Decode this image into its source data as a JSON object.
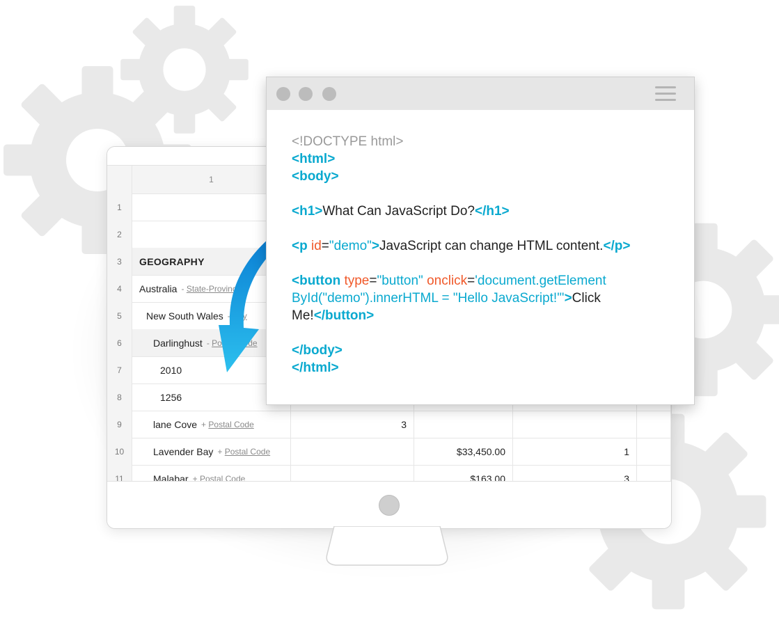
{
  "spreadsheet": {
    "column_header": "1",
    "rows": [
      {
        "num": "1",
        "label": "",
        "sub_prefix": "",
        "sub_link": "",
        "values": [
          "",
          "",
          "",
          ""
        ]
      },
      {
        "num": "2",
        "label": "",
        "sub_prefix": "",
        "sub_link": "",
        "values": [
          "",
          "",
          "",
          ""
        ]
      },
      {
        "num": "3",
        "label": "GEOGRAPHY",
        "sub_prefix": "",
        "sub_link": "",
        "values": [
          "",
          "",
          "",
          ""
        ]
      },
      {
        "num": "4",
        "label": "Australia",
        "sub_prefix": "-",
        "sub_link": "State-Province",
        "values": [
          "",
          "",
          "",
          ""
        ]
      },
      {
        "num": "5",
        "label": "New South Wales",
        "sub_prefix": "-",
        "sub_link": "City",
        "values": [
          "",
          "",
          "",
          ""
        ]
      },
      {
        "num": "6",
        "label": "Darlinghust",
        "sub_prefix": "-",
        "sub_link": "Postal Code",
        "values": [
          "",
          "",
          "",
          ""
        ]
      },
      {
        "num": "7",
        "label": "2010",
        "sub_prefix": "",
        "sub_link": "",
        "values": [
          "",
          "",
          "",
          ""
        ]
      },
      {
        "num": "8",
        "label": "1256",
        "sub_prefix": "",
        "sub_link": "",
        "values": [
          "",
          "",
          "",
          ""
        ]
      },
      {
        "num": "9",
        "label": "lane Cove",
        "sub_prefix": "+",
        "sub_link": "Postal Code",
        "values": [
          "3",
          "",
          "",
          ""
        ]
      },
      {
        "num": "10",
        "label": "Lavender Bay",
        "sub_prefix": "+",
        "sub_link": "Postal Code",
        "values": [
          "",
          "$33,450.00",
          "1",
          ""
        ]
      },
      {
        "num": "11",
        "label": "Malabar",
        "sub_prefix": "+",
        "sub_link": "Postal Code",
        "values": [
          "",
          "$163.00",
          "3",
          ""
        ]
      }
    ]
  },
  "code_window": {
    "lines": [
      [
        {
          "t": "<!DOCTYPE html>",
          "k": "doctype"
        }
      ],
      [
        {
          "t": "<html>",
          "k": "tag"
        }
      ],
      [
        {
          "t": "<body>",
          "k": "tag"
        }
      ],
      [],
      [
        {
          "t": "<h1>",
          "k": "tag"
        },
        {
          "t": "What Can JavaScript Do?",
          "k": "text"
        },
        {
          "t": "</h1>",
          "k": "tag"
        }
      ],
      [],
      [
        {
          "t": "<p ",
          "k": "tag"
        },
        {
          "t": "id",
          "k": "attr"
        },
        {
          "t": "=",
          "k": "eq"
        },
        {
          "t": "\"demo\"",
          "k": "str"
        },
        {
          "t": ">",
          "k": "tag"
        },
        {
          "t": "JavaScript can change HTML content.",
          "k": "text"
        },
        {
          "t": "</p>",
          "k": "tag"
        }
      ],
      [],
      [
        {
          "t": "<button ",
          "k": "tag"
        },
        {
          "t": "type",
          "k": "attr"
        },
        {
          "t": "=",
          "k": "eq"
        },
        {
          "t": "\"button\"",
          "k": "str"
        },
        {
          "t": " onclick",
          "k": "attr"
        },
        {
          "t": "=",
          "k": "eq"
        },
        {
          "t": "'document.getElement",
          "k": "str"
        }
      ],
      [
        {
          "t": "ById(\"demo\").innerHTML = \"Hello JavaScript!\"'",
          "k": "str"
        },
        {
          "t": ">",
          "k": "tag"
        },
        {
          "t": "Click",
          "k": "text"
        }
      ],
      [
        {
          "t": "Me!",
          "k": "text"
        },
        {
          "t": "</button>",
          "k": "tag"
        }
      ],
      [],
      [
        {
          "t": "</body>",
          "k": "tag"
        }
      ],
      [
        {
          "t": "</html>",
          "k": "tag"
        }
      ]
    ]
  },
  "colors": {
    "tag": "#0aa9cf",
    "attr": "#f0592a",
    "doctype": "#9a9a9a",
    "text": "#222222",
    "arrow": "#1a9ee0",
    "gear": "#e9e9e9"
  },
  "icons": {
    "window_controls": [
      "circle-icon",
      "circle-icon",
      "circle-icon"
    ],
    "menu": "hamburger-menu-icon",
    "arrow": "curved-arrow-icon",
    "background": "gear-icon"
  }
}
